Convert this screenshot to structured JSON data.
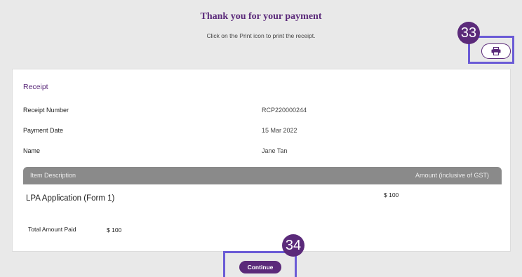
{
  "header": {
    "title": "Thank you for your payment",
    "subtitle": "Click on the Print icon to print the receipt."
  },
  "annotations": {
    "print_step": "33",
    "continue_step": "34"
  },
  "print_button": {
    "icon": "printer-icon"
  },
  "receipt": {
    "heading": "Receipt",
    "fields": [
      {
        "label": "Receipt Number",
        "value": "RCP220000244"
      },
      {
        "label": "Payment Date",
        "value": "15 Mar 2022"
      },
      {
        "label": "Name",
        "value": "Jane Tan"
      }
    ],
    "table": {
      "headers": {
        "description": "Item Description",
        "amount": "Amount (inclusive of GST)"
      },
      "rows": [
        {
          "description": "LPA Application (Form 1)",
          "amount": "$ 100"
        }
      ]
    },
    "total": {
      "label": "Total Amount Paid",
      "value": "$ 100"
    }
  },
  "continue_label": "Continue",
  "colors": {
    "accent": "#5b2a7a",
    "highlight": "#6b5bd6",
    "table_header": "#8a8a8a"
  }
}
